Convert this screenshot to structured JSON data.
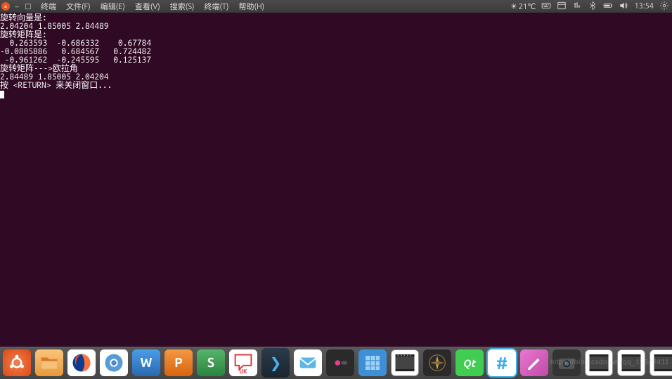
{
  "window": {
    "close": "×",
    "min": "–",
    "max": "□"
  },
  "menu": {
    "app": "终端",
    "file": "文件(F)",
    "edit": "编辑(E)",
    "view": "查看(V)",
    "search": "搜索(S)",
    "terminal": "终端(T)",
    "help": "帮助(H)"
  },
  "tray": {
    "weather_icon": "☀",
    "temperature": "21℃",
    "clock": "13:54"
  },
  "terminal_output": {
    "l1": "旋转向量是:",
    "l2": "2.04204 1.85005 2.84489",
    "l3": "旋转矩阵是:",
    "l4": "  0.263593  -0.686332    0.67784",
    "l5": "-0.0805886   0.684567   0.724482",
    "l6": " -0.961262  -0.245595   0.125137",
    "l7": "旋转矩阵--->欧拉角",
    "l8": "2.84489 1.85005 2.04204",
    "l9": "按 <RETURN> 来关闭窗口..."
  },
  "dock": {
    "items": [
      {
        "name": "ubuntu",
        "bg": "#dd4814",
        "glyph": ""
      },
      {
        "name": "files",
        "bg": "#f0a43a",
        "glyph": ""
      },
      {
        "name": "firefox",
        "bg": "#0a84ff",
        "glyph": ""
      },
      {
        "name": "chromium",
        "bg": "#4aa8f0",
        "glyph": ""
      },
      {
        "name": "wps-writer",
        "bg": "#2e7dd1",
        "glyph": "W"
      },
      {
        "name": "wps-presentation",
        "bg": "#e77817",
        "glyph": "P"
      },
      {
        "name": "wps-spreadsheets",
        "bg": "#3a9b52",
        "glyph": "S"
      },
      {
        "name": "ubuntu-kylin-software",
        "bg": "#fff",
        "glyph": "UK"
      },
      {
        "name": "terminal-ide",
        "bg": "#262a33",
        "glyph": "❯"
      },
      {
        "name": "mail",
        "bg": "#fff",
        "glyph": ""
      },
      {
        "name": "media",
        "bg": "#2a2a2a",
        "glyph": "●"
      },
      {
        "name": "apps",
        "bg": "#3daee9",
        "glyph": ""
      },
      {
        "name": "video1",
        "bg": "#fff",
        "glyph": ""
      },
      {
        "name": "compass",
        "bg": "#2a2a2a",
        "glyph": "✦"
      },
      {
        "name": "qt",
        "bg": "#41cd52",
        "glyph": "Qt"
      },
      {
        "name": "hash",
        "bg": "#fff",
        "glyph": "#"
      },
      {
        "name": "notes",
        "bg": "#d864c4",
        "glyph": ""
      },
      {
        "name": "camera",
        "bg": "#333",
        "glyph": ""
      },
      {
        "name": "video2",
        "bg": "#fff",
        "glyph": ""
      },
      {
        "name": "video3",
        "bg": "#fff",
        "glyph": ""
      },
      {
        "name": "video4",
        "bg": "#fff",
        "glyph": ""
      },
      {
        "name": "video5",
        "bg": "#fff",
        "glyph": ""
      },
      {
        "name": "video6",
        "bg": "#fff",
        "glyph": ""
      }
    ]
  },
  "watermark": "https://blog.csdn.net/qq_15642411"
}
